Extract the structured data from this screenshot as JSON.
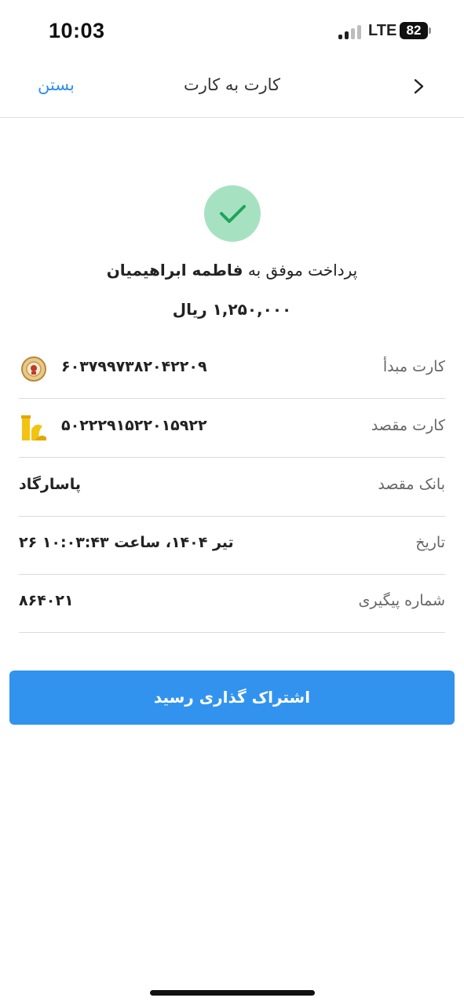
{
  "status_bar": {
    "time": "10:03",
    "network": "LTE",
    "battery": "82"
  },
  "nav": {
    "close_label": "بستن",
    "title": "کارت به کارت",
    "back_icon": "chevron-right-icon"
  },
  "success": {
    "icon": "check-icon",
    "prefix": "پرداخت موفق به",
    "recipient": "فاطمه ابراهیمیان",
    "amount": "۱,۲۵۰,۰۰۰ ریال"
  },
  "details": {
    "source_card": {
      "label": "کارت مبدأ",
      "value": "۶۰۳۷۹۹۷۳۸۲۰۴۲۲۰۹",
      "icon": "bank-melli-logo"
    },
    "dest_card": {
      "label": "کارت مقصد",
      "value": "۵۰۲۲۲۹۱۵۲۲۰۱۵۹۲۲",
      "icon": "bank-pasargad-logo"
    },
    "dest_bank": {
      "label": "بانک مقصد",
      "value": "پاسارگاد"
    },
    "date": {
      "label": "تاریخ",
      "value": "۲۶ تیر ۱۴۰۴، ساعت ۱۰:۰۳:۴۳"
    },
    "tracking": {
      "label": "شماره پیگیری",
      "value": "۸۶۴۰۲۱"
    }
  },
  "share_button": "اشتراک گذاری رسید",
  "colors": {
    "accent": "#3293ef",
    "success_bg": "#a6e2c2",
    "success_check": "#1fa45a"
  }
}
